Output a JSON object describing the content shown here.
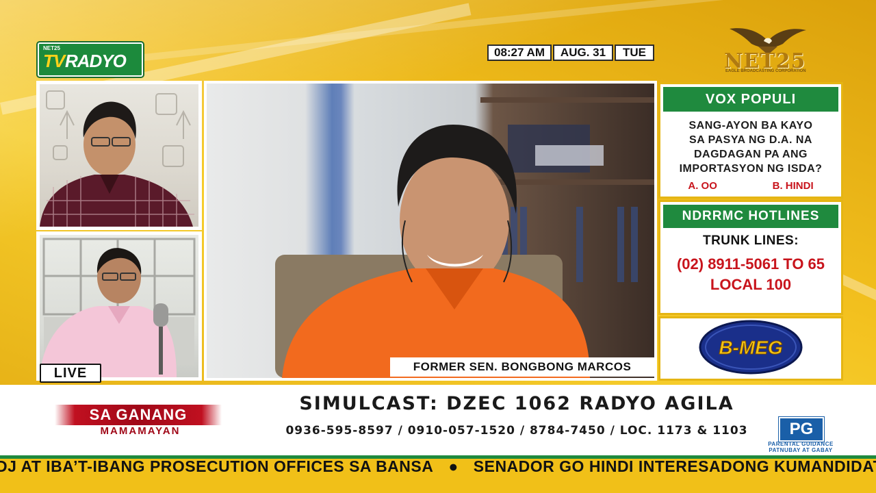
{
  "branding": {
    "channel_logo_small": "NET25",
    "channel_logo_tv": "TV",
    "channel_logo_radyo": "RADYO",
    "network_logo": "NET25",
    "network_sub": "EAGLE BROADCASTING CORPORATION"
  },
  "clock": {
    "time": "08:27 AM",
    "date": "AUG. 31",
    "day": "TUE"
  },
  "guest_caption": "FORMER SEN. BONGBONG MARCOS",
  "live_label": "LIVE",
  "vox_populi": {
    "title": "VOX POPULI",
    "question_lines": [
      "SANG-AYON BA KAYO",
      "SA PASYA NG D.A. NA",
      "DAGDAGAN PA ANG",
      "IMPORTASYON NG ISDA?"
    ],
    "option_a": "A. OO",
    "option_b": "B. HINDI"
  },
  "hotlines": {
    "title": "NDRRMC HOTLINES",
    "subtitle": "TRUNK LINES:",
    "number": "(02) 8911-5061 TO 65",
    "local": "LOCAL 100"
  },
  "sponsor": "B-MEG",
  "program": {
    "title": "SA GANANG",
    "subtitle": "MAMAMAYAN"
  },
  "simulcast": "SIMULCAST: DZEC 1062 RADYO AGILA",
  "phones": "0936-595-8597 / 0910-057-1520 / 8784-7450 / LOC. 1173 & 1103",
  "rating": {
    "label": "PG",
    "line1": "PARENTAL GUIDANCE",
    "line2": "PATNUBAY AT GABAY"
  },
  "ticker": {
    "item1": "DJ AT IBA’T-IBANG PROSECUTION OFFICES SA BANSA",
    "item2": "SENADOR GO HINDI INTERESADONG KUMANDIDATO S"
  },
  "colors": {
    "green": "#1f8a3e",
    "red": "#c8141c",
    "gold": "#f1c018",
    "pg_blue": "#1a5fa8"
  }
}
